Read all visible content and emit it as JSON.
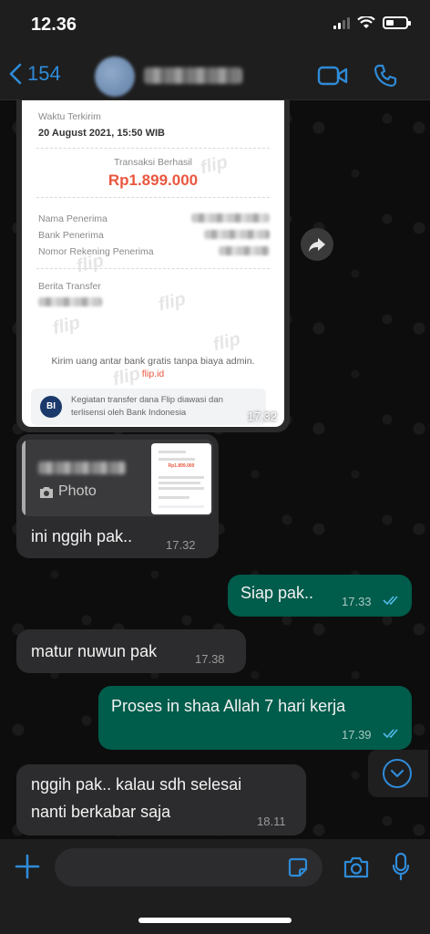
{
  "status_bar": {
    "time": "12.36"
  },
  "header": {
    "back_count": "154"
  },
  "receipt": {
    "sent_time_label": "Waktu Terkirim",
    "sent_time_value": "20 August 2021, 15:50 WIB",
    "status_label": "Transaksi Berhasil",
    "amount": "Rp1.899.000",
    "recipient_name_label": "Nama Penerima",
    "recipient_bank_label": "Bank Penerima",
    "recipient_account_label": "Nomor Rekening Penerima",
    "transfer_note_label": "Berita Transfer",
    "footer_text": "Kirim uang antar bank gratis tanpa biaya admin.",
    "footer_link": "flip.id",
    "bi_logo": "BI",
    "bi_note": "Kegiatan transfer dana Flip diawasi dan terlisensi oleh Bank Indonesia",
    "watermark": "flip",
    "time": "17.32"
  },
  "messages": [
    {
      "direction": "in",
      "quote_label": "Photo",
      "text": "ini nggih pak..",
      "time": "17.32"
    },
    {
      "direction": "out",
      "text": "Siap pak..",
      "time": "17.33",
      "status": "read"
    },
    {
      "direction": "in",
      "text": "matur nuwun pak",
      "time": "17.38"
    },
    {
      "direction": "out",
      "text": "Proses in shaa Allah 7 hari kerja",
      "time": "17.39",
      "status": "read"
    },
    {
      "direction": "in",
      "text_line1": "nggih pak.. kalau sdh selesai",
      "text_line2": "nanti berkabar saja",
      "time": "18.11"
    }
  ],
  "quote_thumb_amount": "Rp1.899.000",
  "input": {
    "placeholder": ""
  },
  "colors": {
    "accent": "#2f8bd8",
    "outgoing_bubble": "#005c4b",
    "incoming_bubble": "#2c2c2e",
    "amount": "#e9573f"
  }
}
